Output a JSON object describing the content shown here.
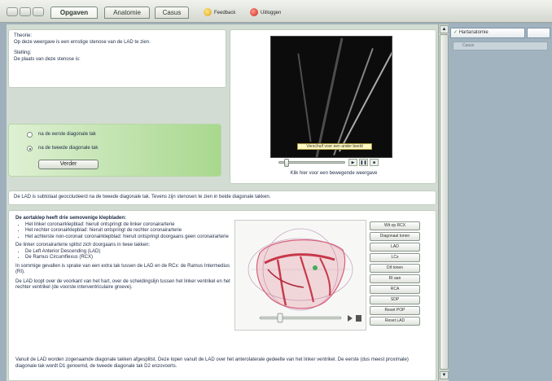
{
  "toolbar": {
    "tabs": [
      "Opgaven",
      "Anatomie",
      "Casus"
    ],
    "active_tab": "Opgaven",
    "feedback_label": "Feedback",
    "logout_label": "Uitloggen"
  },
  "question": {
    "theory_label": "Theorie:",
    "theory_text": "Op deze weergave is een ernstige stenose van de LAD te zien.",
    "statement_label": "Stelling:",
    "statement_text": "De plaats van deze stenose is:"
  },
  "answers": {
    "options": [
      "na de eerste diagonale tak",
      "na de tweede diagonale tak"
    ],
    "selected_index": 1,
    "submit_label": "Verder"
  },
  "angio_viewer": {
    "tooltip": "Verschuif voor een ander beeld",
    "caption": "Klik hier voor een bewegende weergave",
    "slider_position": 0.12
  },
  "feedback_text": "De LAD is subtotaal geoccludeerd na de tweede diagonale tak. Tevens zijn stenosen te zien in beide diagonale takken.",
  "anatomy": {
    "intro": "De aortaklep heeft drie semovenige klepbladen:",
    "valve_items": [
      "Het linker coronairklepblad: hieruit ontspringt de linker coronairarterie",
      "Het rechter coronairklepblad: hieruit ontspringt de rechter coronairarterie",
      "Het achterste non-coronair coronairklepblad: hieruit ontspringt doorgaans geen coronairarterie"
    ],
    "split_text": "De linker coronairarterie splitst zich doorgaans in twee takken:",
    "branch_items": [
      "De Left Anterior Descending (LAD)",
      "De Ramus Circumflexus (RCX)"
    ],
    "extra_text": "In sommige gevallen is sprake van een extra tak tussen de LAD en de RCx: de Ramus Intermedius (RI).",
    "lad_text": "De LAD loopt over de voorkant van het hart, over de scheidingslijn tussen het linker ventrikel en het rechter ventrikel (de voorste interventriculaire groeve).",
    "bottom_text": "Vanuit de LAD worden zogenaamde diagonale takken afgesplitst. Deze lopen vanuit de LAD over het anterolaterale gedeelte van het linker ventrikel. De eerste (dus meest proximale) diagonale tak wordt D1 genoemd, de tweede diagonale tak D2 enzovoorts."
  },
  "model_buttons": [
    "Wit op RCX",
    "Diagonaal tonen",
    "LAD",
    "LCx",
    "Dif tonen",
    "RI aan",
    "RCA",
    "SDP",
    "Reset POP",
    "Reset LAD"
  ],
  "model_viewer": {
    "slider_position": 0.25
  },
  "right_panel": {
    "tab_label": "Hartanatomie",
    "search_placeholder": "Casus"
  },
  "colors": {
    "accent_green": "#a8d88e",
    "heart_red": "#c8384a",
    "right_pane": "#a2b3c0"
  }
}
